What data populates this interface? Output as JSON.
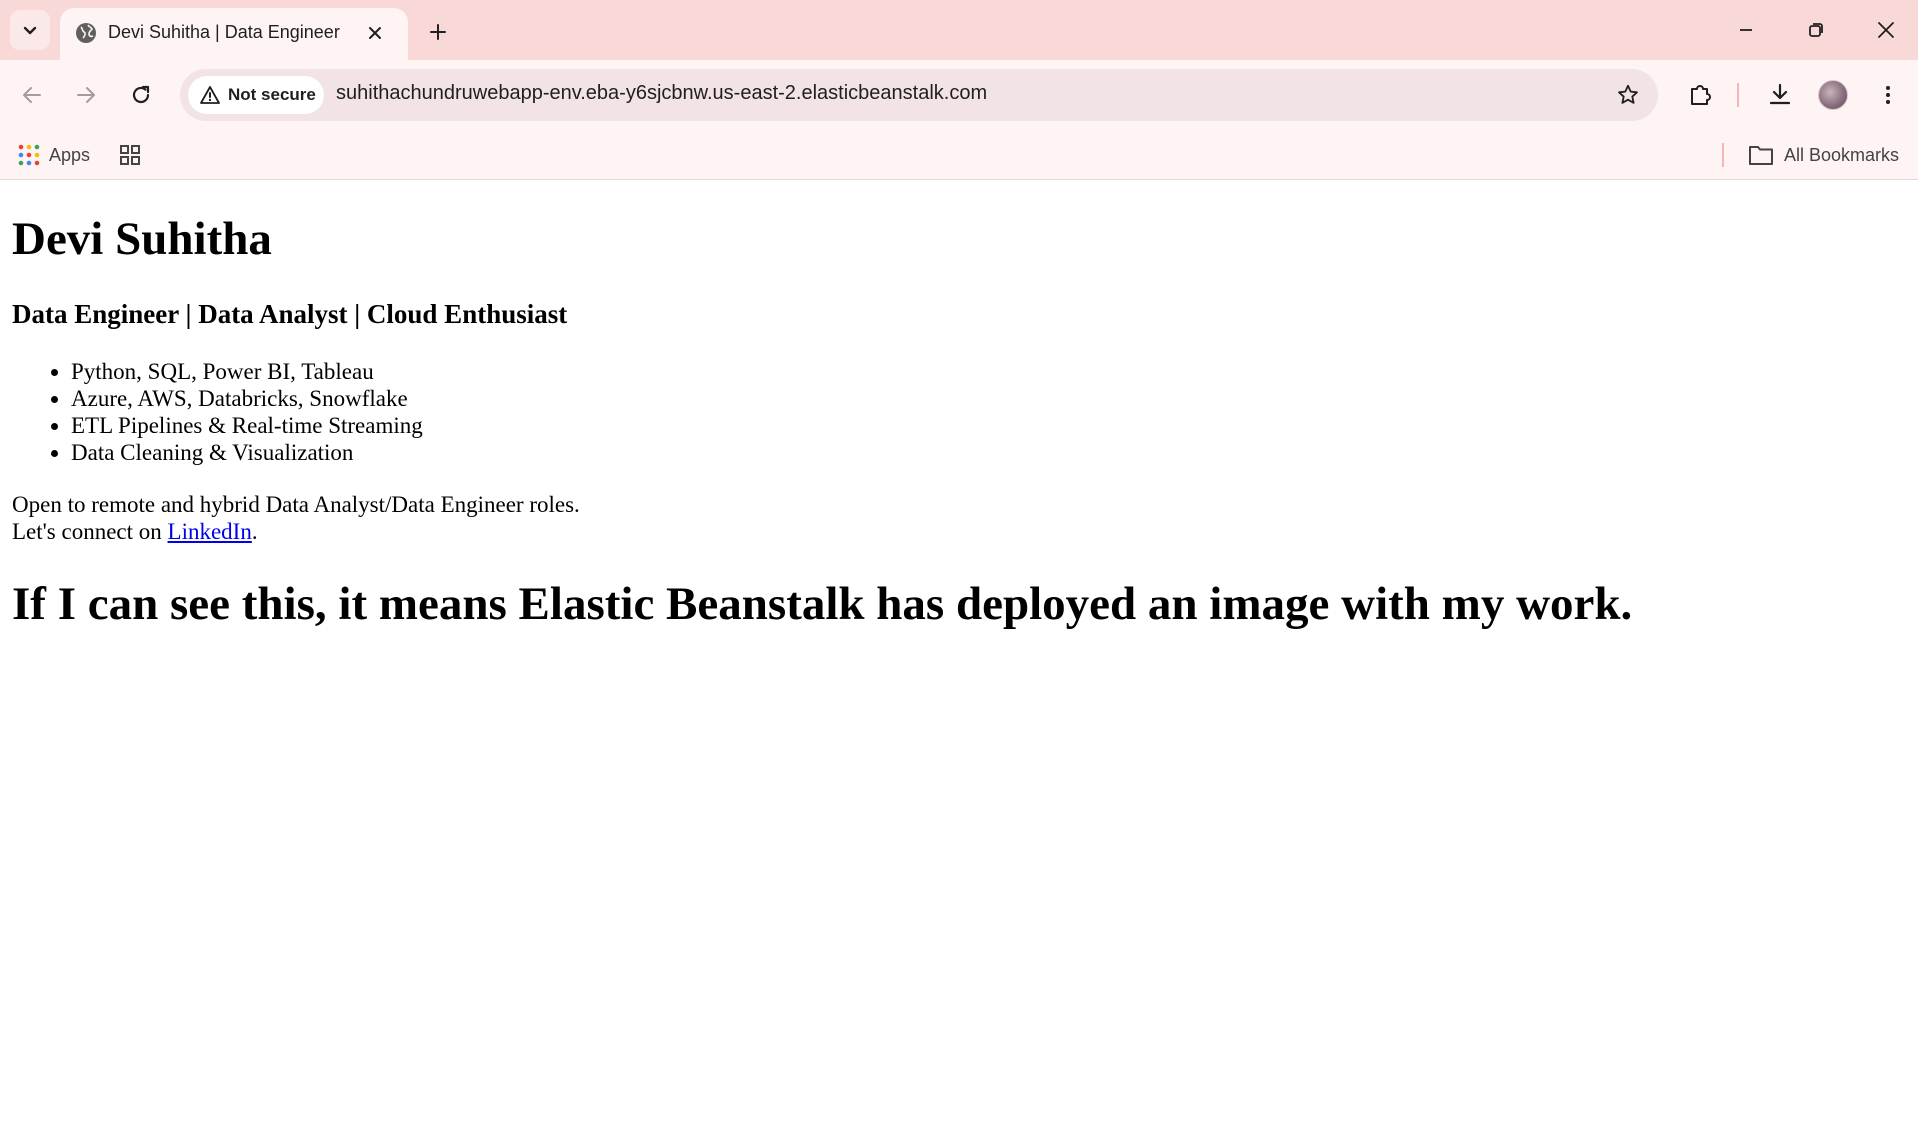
{
  "browser": {
    "tab": {
      "title": "Devi Suhitha | Data Engineer"
    },
    "omnibox": {
      "security_label": "Not secure",
      "url": "suhithachundruwebapp-env.eba-y6sjcbnw.us-east-2.elasticbeanstalk.com"
    },
    "bookmarks": {
      "apps_label": "Apps",
      "all_bookmarks_label": "All Bookmarks"
    },
    "icons": {
      "tab_search": "chevron-down-icon",
      "favicon": "globe-icon",
      "tab_close": "close-icon",
      "new_tab": "plus-icon",
      "minimize": "minimize-icon",
      "restore": "restore-icon",
      "close_window": "close-icon",
      "back": "arrow-left-icon",
      "forward": "arrow-right-icon",
      "reload": "reload-icon",
      "warning": "warning-icon",
      "bookmark_star": "star-icon",
      "extensions": "puzzle-icon",
      "downloads": "download-icon",
      "menu": "kebab-menu-icon",
      "apps_grid": "apps-grid-icon",
      "tab_groups": "tab-groups-icon",
      "folder": "folder-icon"
    },
    "colors": {
      "tabbar_bg": "#f9d9d8",
      "toolbar_bg": "#fdf4f3",
      "omnibox_bg": "#f2e3e5",
      "link": "#0000ee"
    }
  },
  "page": {
    "name": "Devi Suhitha",
    "tagline": "Data Engineer | Data Analyst | Cloud Enthusiast",
    "skills": [
      "Python, SQL, Power BI, Tableau",
      "Azure, AWS, Databricks, Snowflake",
      "ETL Pipelines & Real-time Streaming",
      "Data Cleaning & Visualization"
    ],
    "open_to": "Open to remote and hybrid Data Analyst/Data Engineer roles.",
    "connect_prefix": "Let's connect on ",
    "connect_link": "LinkedIn",
    "connect_suffix": ".",
    "deploy_message": "If I can see this, it means Elastic Beanstalk has deployed an image with my work."
  }
}
